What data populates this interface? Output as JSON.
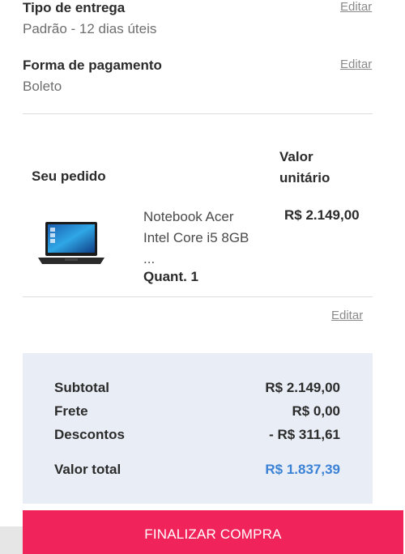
{
  "delivery": {
    "title": "Tipo de entrega",
    "value": "Padrão - 12 dias úteis",
    "edit_label": "Editar"
  },
  "payment": {
    "title": "Forma de pagamento",
    "value": "Boleto",
    "edit_label": "Editar"
  },
  "order": {
    "heading": "Seu pedido",
    "unit_price_heading_line1": "Valor",
    "unit_price_heading_line2": "unitário",
    "product": {
      "name_line1": "Notebook Acer",
      "name_line2": "Intel Core i5 8GB",
      "name_line3": "...",
      "quantity": "Quant. 1",
      "unit_price": "R$ 2.149,00",
      "image_icon": "laptop-icon"
    },
    "edit_label": "Editar"
  },
  "summary": {
    "subtotal_label": "Subtotal",
    "subtotal_value": "R$ 2.149,00",
    "shipping_label": "Frete",
    "shipping_value": "R$ 0,00",
    "discount_label": "Descontos",
    "discount_value": "- R$ 311,61",
    "total_label": "Valor total",
    "total_value": "R$ 1.837,39"
  },
  "cta": {
    "label": "FINALIZAR COMPRA"
  },
  "colors": {
    "accent": "#f0245a",
    "total_blue": "#3b82d6",
    "summary_bg": "#e9eef6"
  }
}
